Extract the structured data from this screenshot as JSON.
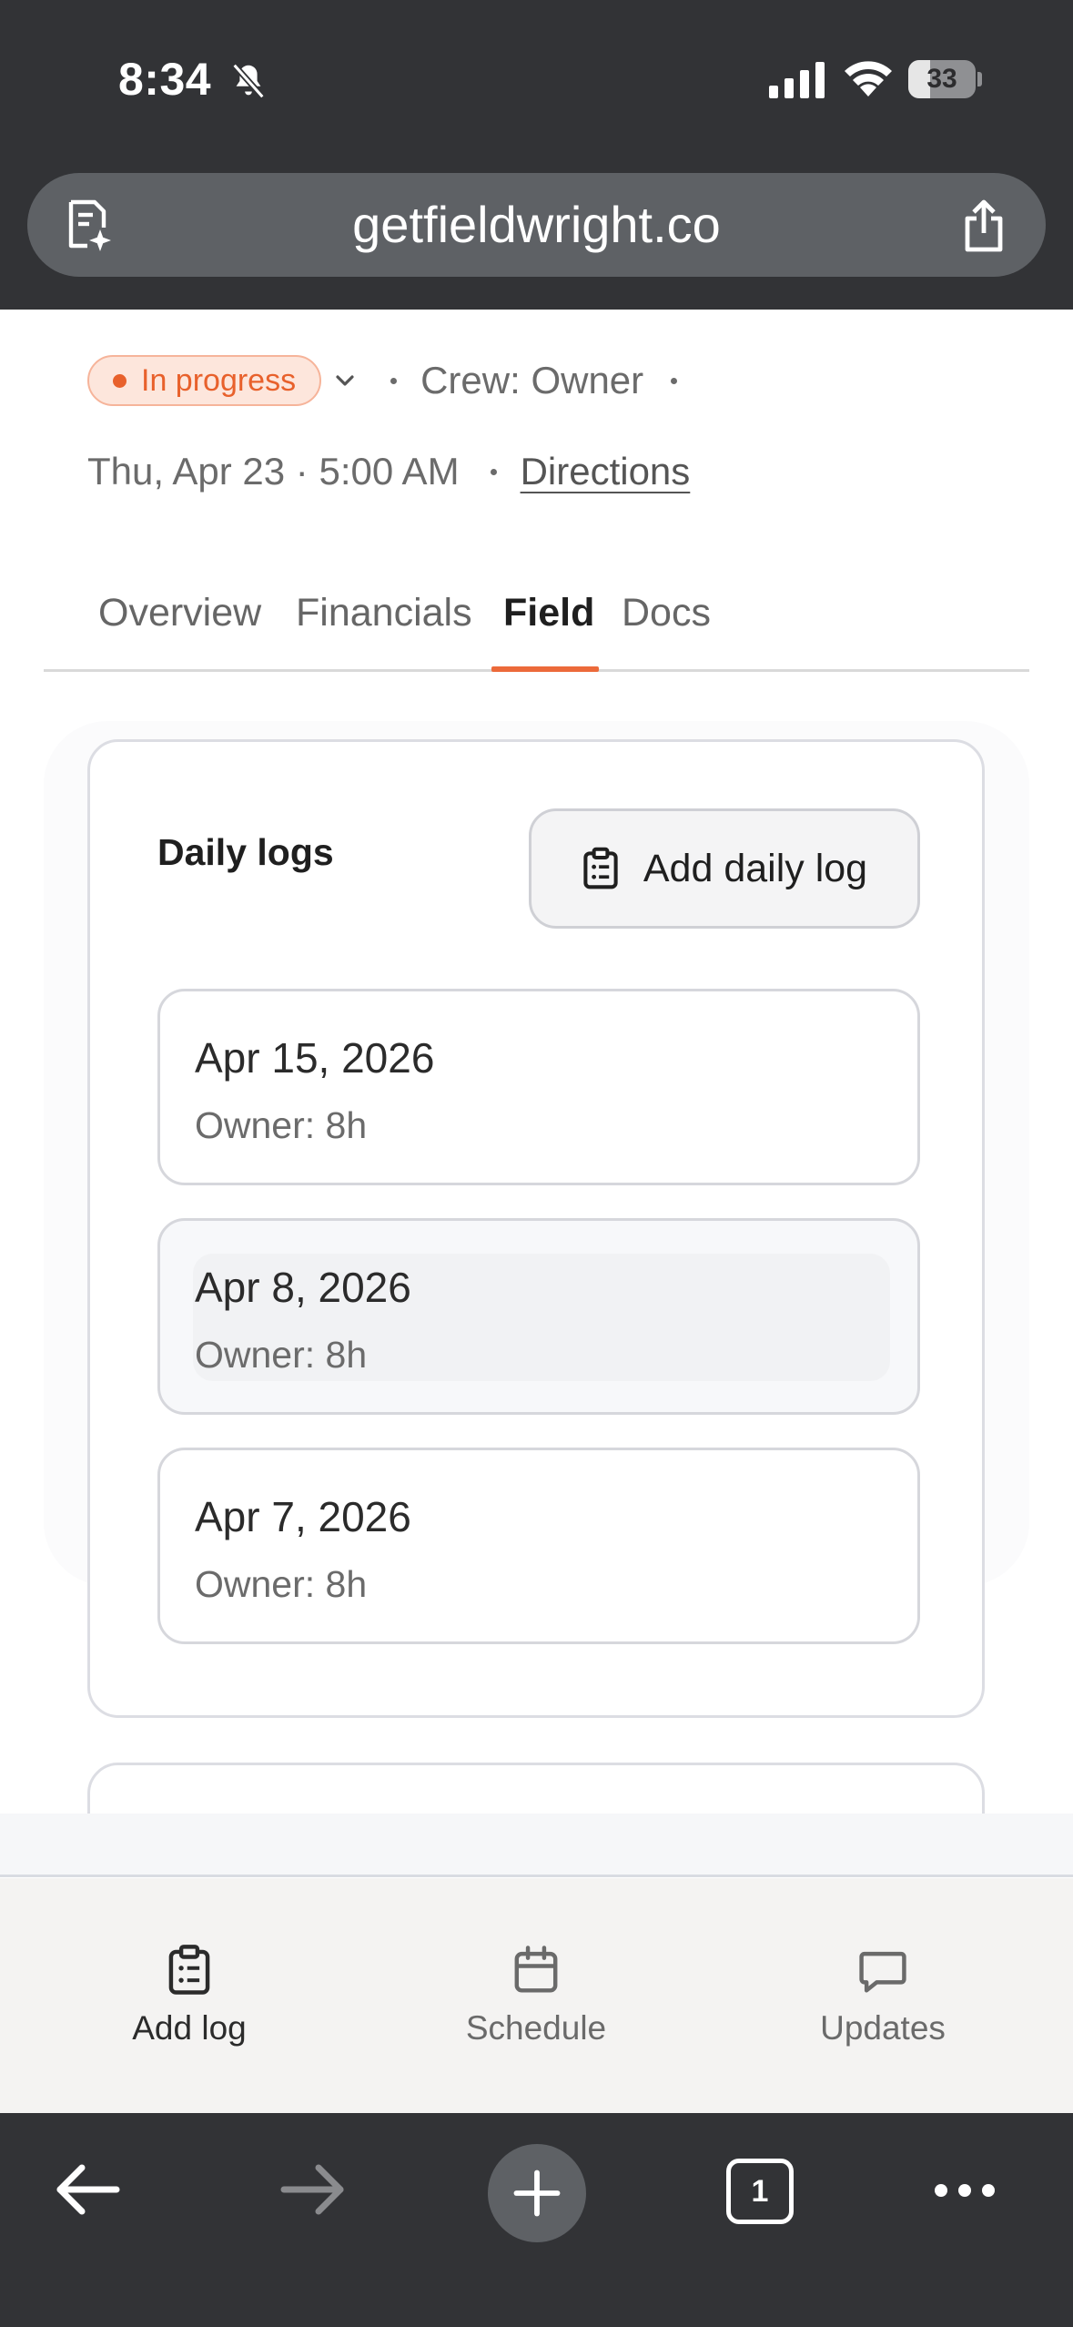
{
  "status_bar": {
    "time": "8:34",
    "battery": "33",
    "battery_level": 0.33
  },
  "browser": {
    "url": "getfieldwright.co",
    "open_tabs": "1"
  },
  "job": {
    "status": "In progress",
    "crew": "Crew: Owner",
    "datetime": "Thu, Apr 23 · 5:00 AM",
    "directions": "Directions"
  },
  "tabs": [
    {
      "label": "Overview",
      "active": false
    },
    {
      "label": "Financials",
      "active": false
    },
    {
      "label": "Field",
      "active": true
    },
    {
      "label": "Docs",
      "active": false
    }
  ],
  "daily_logs": {
    "title": "Daily logs",
    "add_button": "Add daily log",
    "items": [
      {
        "date": "Apr 15, 2026",
        "hours": "Owner: 8h"
      },
      {
        "date": "Apr 8, 2026",
        "hours": "Owner: 8h"
      },
      {
        "date": "Apr 7, 2026",
        "hours": "Owner: 8h"
      }
    ]
  },
  "bottom_nav": {
    "items": [
      {
        "label": "Add log",
        "icon": "clipboard-list-icon"
      },
      {
        "label": "Schedule",
        "icon": "calendar-icon"
      },
      {
        "label": "Updates",
        "icon": "chat-bubble-icon"
      }
    ]
  },
  "colors": {
    "accent": "#ec6a3a",
    "status_text": "#e8612c",
    "status_bg": "#fde6dc",
    "chrome": "#323336"
  }
}
